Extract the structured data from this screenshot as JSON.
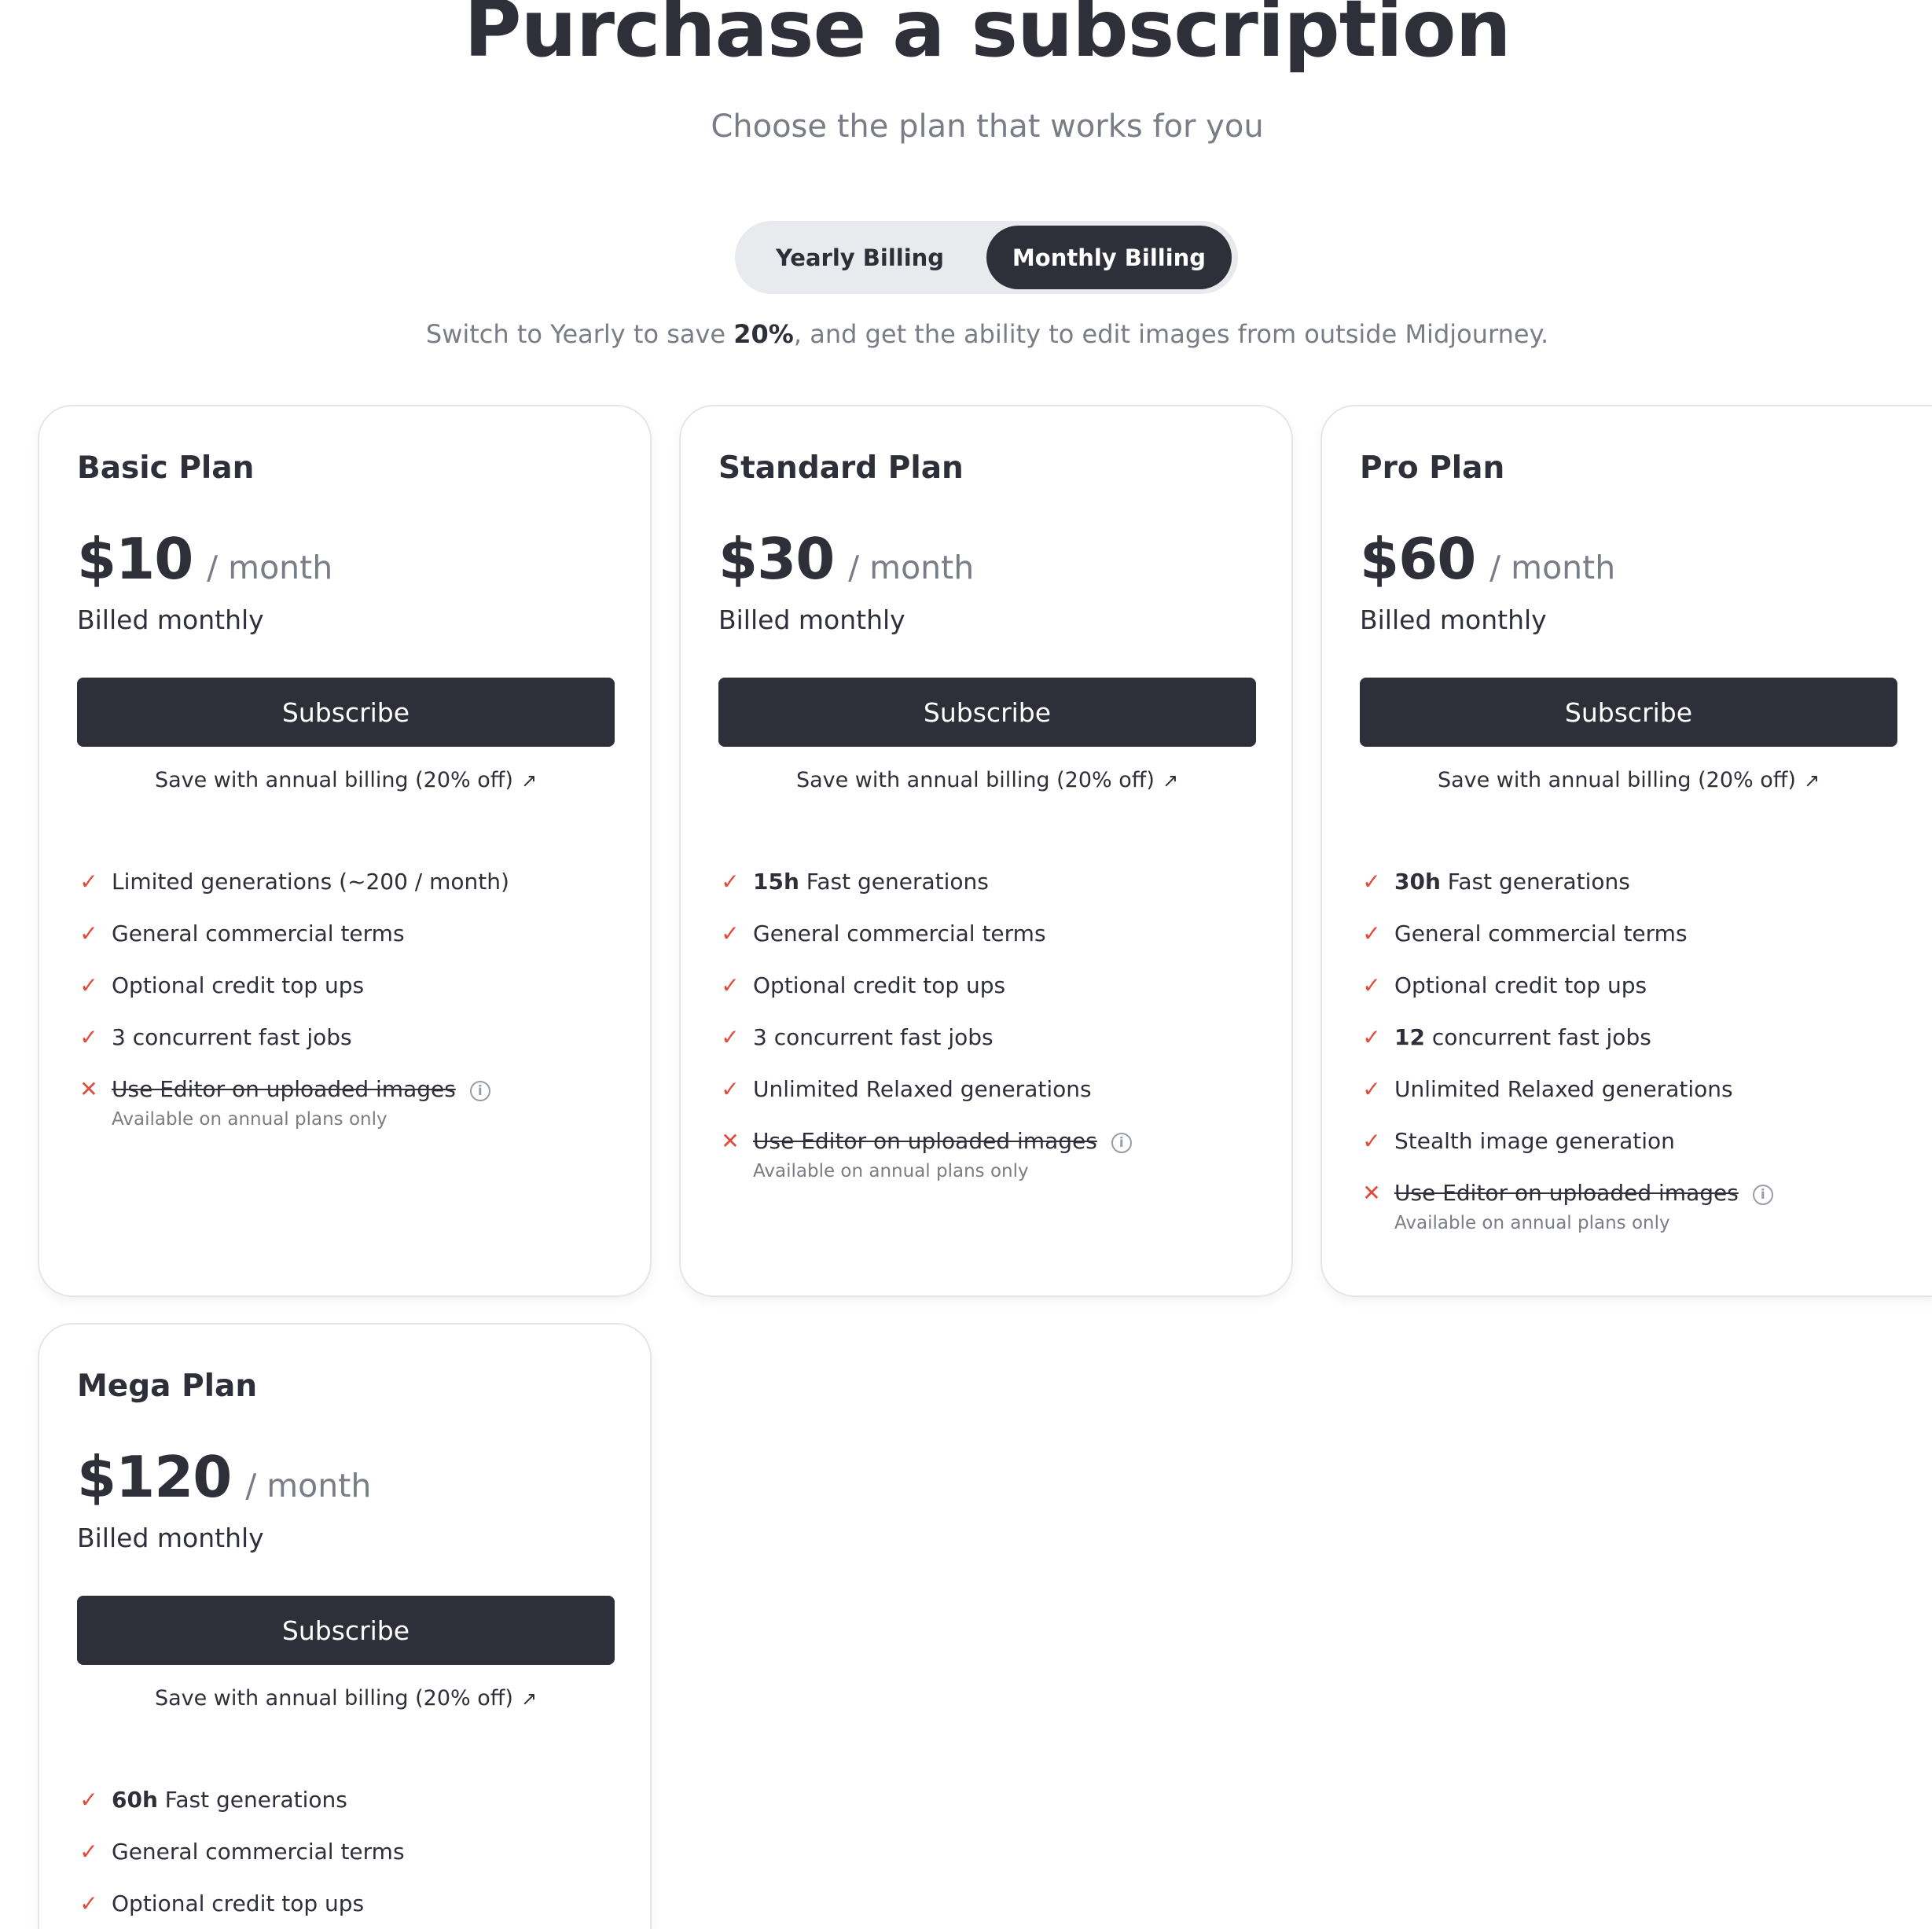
{
  "header": {
    "title": "Purchase a subscription",
    "subtitle": "Choose the plan that works for you"
  },
  "billing_toggle": {
    "yearly_label": "Yearly Billing",
    "monthly_label": "Monthly Billing",
    "selected": "Monthly Billing"
  },
  "note": {
    "prefix": "Switch to Yearly to save ",
    "highlight": "20%",
    "suffix": ", and get the ability to edit images from outside Midjourney."
  },
  "plans": [
    {
      "name": "Basic Plan",
      "price": "$10",
      "period": "/ month",
      "billed": "Billed monthly",
      "subscribe_label": "Subscribe",
      "annual_link": "Save with annual billing (20% off)",
      "features": [
        {
          "bold": "",
          "text": "Limited generations (~200 / month)"
        },
        {
          "bold": "",
          "text": "General commercial terms"
        },
        {
          "bold": "",
          "text": "Optional credit top ups"
        },
        {
          "bold": "",
          "text": "3 concurrent fast jobs"
        }
      ],
      "excluded": {
        "text": "Use Editor on uploaded images",
        "note": "Available on annual plans only"
      }
    },
    {
      "name": "Standard Plan",
      "price": "$30",
      "period": "/ month",
      "billed": "Billed monthly",
      "subscribe_label": "Subscribe",
      "annual_link": "Save with annual billing (20% off)",
      "features": [
        {
          "bold": "15h",
          "text": " Fast generations"
        },
        {
          "bold": "",
          "text": "General commercial terms"
        },
        {
          "bold": "",
          "text": "Optional credit top ups"
        },
        {
          "bold": "",
          "text": "3 concurrent fast jobs"
        },
        {
          "bold": "",
          "text": "Unlimited Relaxed generations"
        }
      ],
      "excluded": {
        "text": "Use Editor on uploaded images",
        "note": "Available on annual plans only"
      }
    },
    {
      "name": "Pro Plan",
      "price": "$60",
      "period": "/ month",
      "billed": "Billed monthly",
      "subscribe_label": "Subscribe",
      "annual_link": "Save with annual billing (20% off)",
      "features": [
        {
          "bold": "30h",
          "text": " Fast generations"
        },
        {
          "bold": "",
          "text": "General commercial terms"
        },
        {
          "bold": "",
          "text": "Optional credit top ups"
        },
        {
          "bold": "12",
          "text": " concurrent fast jobs"
        },
        {
          "bold": "",
          "text": "Unlimited Relaxed generations"
        },
        {
          "bold": "",
          "text": "Stealth image generation"
        }
      ],
      "excluded": {
        "text": "Use Editor on uploaded images",
        "note": "Available on annual plans only"
      }
    },
    {
      "name": "Mega Plan",
      "price": "$120",
      "period": "/ month",
      "billed": "Billed monthly",
      "subscribe_label": "Subscribe",
      "annual_link": "Save with annual billing (20% off)",
      "features": [
        {
          "bold": "60h",
          "text": " Fast generations"
        },
        {
          "bold": "",
          "text": "General commercial terms"
        },
        {
          "bold": "",
          "text": "Optional credit top ups"
        }
      ]
    }
  ],
  "icons": {
    "check": "check-icon",
    "cross": "cross-icon",
    "info": "info-icon",
    "external": "external-link-icon"
  },
  "colors": {
    "primary": "#2f2f3a",
    "accent": "#e24a3b",
    "muted": "#7a7c86",
    "toggle_bg": "#e9eaee"
  }
}
